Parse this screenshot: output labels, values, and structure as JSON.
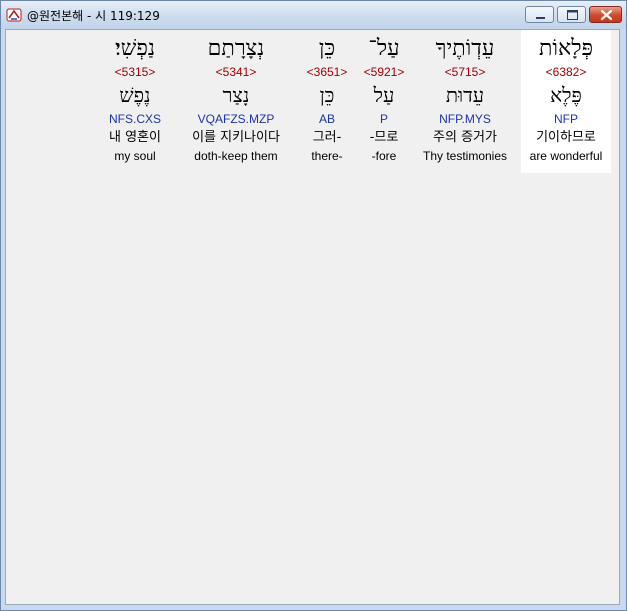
{
  "window": {
    "title": "@원전본해 - 시 119:129"
  },
  "words": [
    {
      "hebrew": "פְּלָאוֹת",
      "strong": "<6382>",
      "root": "פֶּלֶא",
      "translit": "NFP",
      "korean": "기이하므로",
      "english": "are wonderful",
      "selected": true
    },
    {
      "hebrew": "עֵדְוֹתֶיךָ",
      "strong": "<5715>",
      "root": "עֵדוּת",
      "translit": "NFP.MYS",
      "korean": "주의 증거가",
      "english": "Thy testimonies",
      "selected": false
    },
    {
      "hebrew": "עַל־",
      "strong": "<5921>",
      "root": "עַל",
      "translit": "P",
      "korean": "-므로",
      "english": "-fore",
      "selected": false
    },
    {
      "hebrew": "כֵּן",
      "strong": "<3651>",
      "root": "כֵּן",
      "translit": "AB",
      "korean": "그러-",
      "english": "there-",
      "selected": false
    },
    {
      "hebrew": "נְצָרָתַם",
      "strong": "<5341>",
      "root": "נָצַר",
      "translit": "VQAFZS.MZP",
      "korean": "이를 지키나이다",
      "english": "doth-keep them",
      "selected": false
    },
    {
      "hebrew": "נַפְשִׁי׃",
      "strong": "<5315>",
      "root": "נֶפֶשׁ",
      "translit": "NFS.CXS",
      "korean": "내 영혼이",
      "english": "my soul",
      "selected": false
    }
  ],
  "icons": {
    "app": "app-logo-icon",
    "minimize": "minimize-icon",
    "maximize": "maximize-icon",
    "close": "close-icon"
  },
  "colors": {
    "strong_number": "#a00000",
    "transliteration": "#1c35a8",
    "selected_column_bg": "#ffffff",
    "client_bg": "#f0f0f0"
  }
}
